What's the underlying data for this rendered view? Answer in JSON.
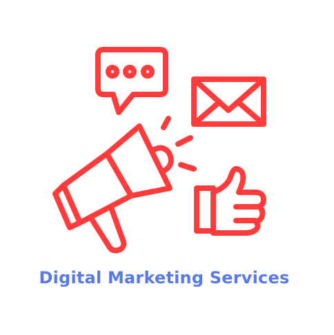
{
  "caption": {
    "text": "Digital Marketing Services",
    "color": "#5a79e8"
  },
  "icons": {
    "color": "#ff3b3b",
    "items": [
      "speech-bubble-icon",
      "envelope-icon",
      "megaphone-icon",
      "thumbs-up-icon"
    ]
  }
}
